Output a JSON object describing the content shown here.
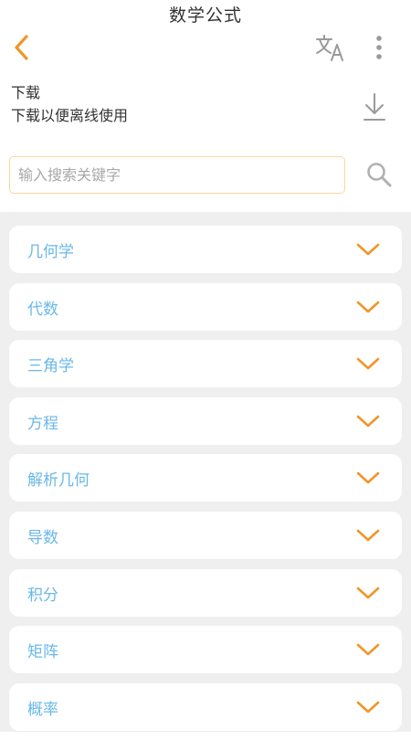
{
  "header": {
    "title": "数学公式",
    "back_icon": "chevron-left-icon",
    "translate_icon": "translate-icon",
    "more_icon": "more-vertical-icon"
  },
  "download": {
    "title": "下载",
    "subtitle": "下载以便离线使用",
    "icon": "download-icon"
  },
  "search": {
    "placeholder": "输入搜索关键字",
    "value": "",
    "icon": "search-icon"
  },
  "colors": {
    "accent": "#f0962a",
    "item_text": "#69b8e8",
    "background": "#efefef",
    "icon_gray": "#9a9a9a"
  },
  "categories": [
    {
      "label": "几何学"
    },
    {
      "label": "代数"
    },
    {
      "label": "三角学"
    },
    {
      "label": "方程"
    },
    {
      "label": "解析几何"
    },
    {
      "label": "导数"
    },
    {
      "label": "积分"
    },
    {
      "label": "矩阵"
    },
    {
      "label": "概率"
    }
  ]
}
